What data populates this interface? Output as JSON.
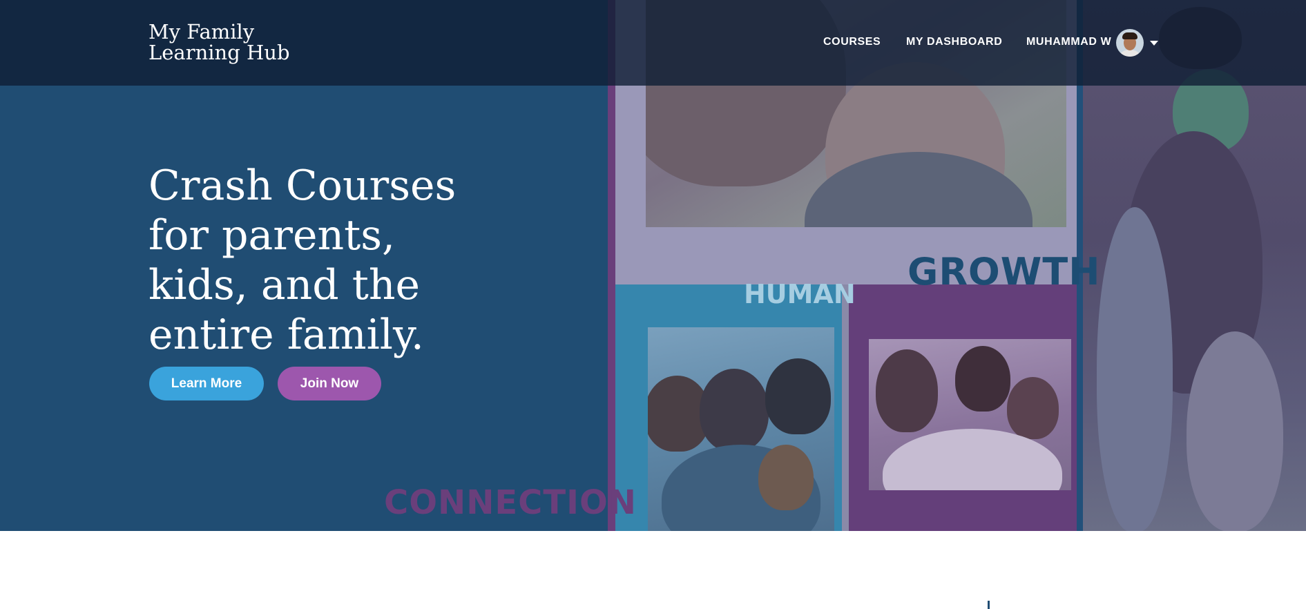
{
  "header": {
    "logo_line1": "My Family",
    "logo_line2": "Learning Hub",
    "nav": {
      "courses": "COURSES",
      "dashboard": "MY DASHBOARD",
      "user_name": "MUHAMMAD W"
    }
  },
  "hero": {
    "title": "Crash Courses for parents, kids, and the entire family.",
    "buttons": {
      "learn_more": "Learn More",
      "join_now": "Join Now"
    },
    "collage_words": {
      "growth": "GROWTH",
      "human": "HUMAN",
      "connection": "CONNECTION"
    }
  },
  "colors": {
    "hero_bg": "#204d73",
    "nav_bg": "#0f1e34",
    "learn_more": "#3aa3dc",
    "join_now": "#9d57ad",
    "collage_purple": "#643f7a",
    "collage_blue": "#3686ad",
    "collage_lavender": "#9a98b8"
  },
  "icons": {
    "user_menu": "chevron-down-icon"
  }
}
